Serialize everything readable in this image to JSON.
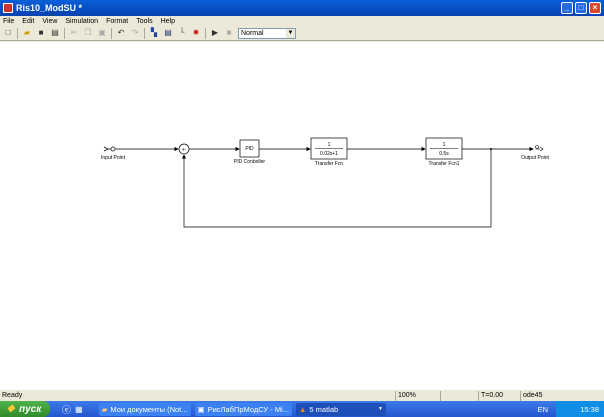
{
  "window": {
    "title": "Ris10_ModSU *"
  },
  "menu": [
    "File",
    "Edit",
    "View",
    "Simulation",
    "Format",
    "Tools",
    "Help"
  ],
  "toolbar": {
    "mode": "Normal"
  },
  "diagram": {
    "input_label": "Input Point",
    "sum_sign": "+-",
    "pid_text": "PID",
    "pid_label": "PID Conboller",
    "tf1_num": "1",
    "tf1_den": "0.02s+1",
    "tf1_label": "Transfer Fcn",
    "tf2_num": "1",
    "tf2_den": "0.5s",
    "tf2_label": "Transfer Fcn1",
    "output_label": "Output Point"
  },
  "status": {
    "text": "Ready",
    "zoom": "100%",
    "time": "T=0.00",
    "solver": "ode45"
  },
  "taskbar": {
    "start": "пуск",
    "tasks": [
      "Мои документы (Not...",
      "РисЛабПрМодСУ - Mi...",
      "5 matlab"
    ],
    "lang": "EN",
    "clock": "15:38"
  }
}
